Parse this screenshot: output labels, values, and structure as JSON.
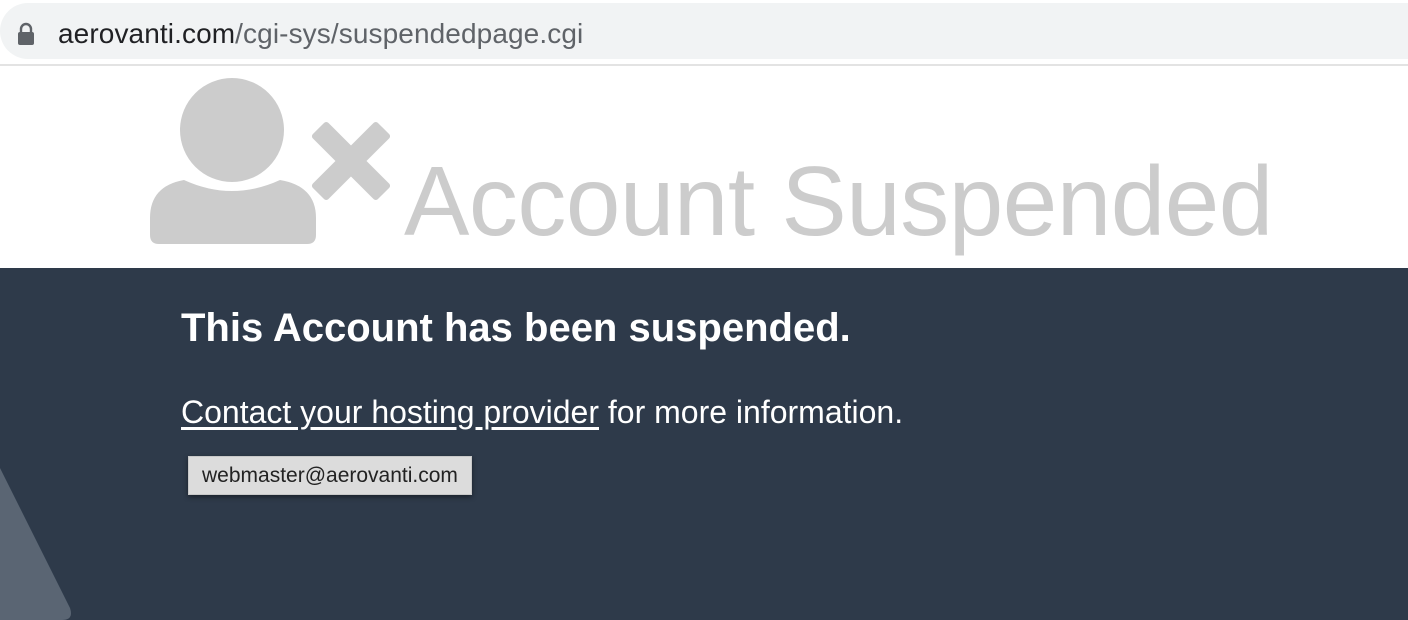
{
  "browser": {
    "url_domain": "aerovanti.com",
    "url_path": "/cgi-sys/suspendedpage.cgi",
    "lock_icon": "lock-icon"
  },
  "header": {
    "title": "Account Suspended",
    "icon": "user-x-icon",
    "title_color": "#cccccc"
  },
  "main": {
    "background_color": "#2e3a4a",
    "headline": "This Account has been suspended.",
    "contact_link_text": "Contact your hosting provider",
    "info_suffix": " for more information.",
    "tooltip_email": "webmaster@aerovanti.com"
  }
}
